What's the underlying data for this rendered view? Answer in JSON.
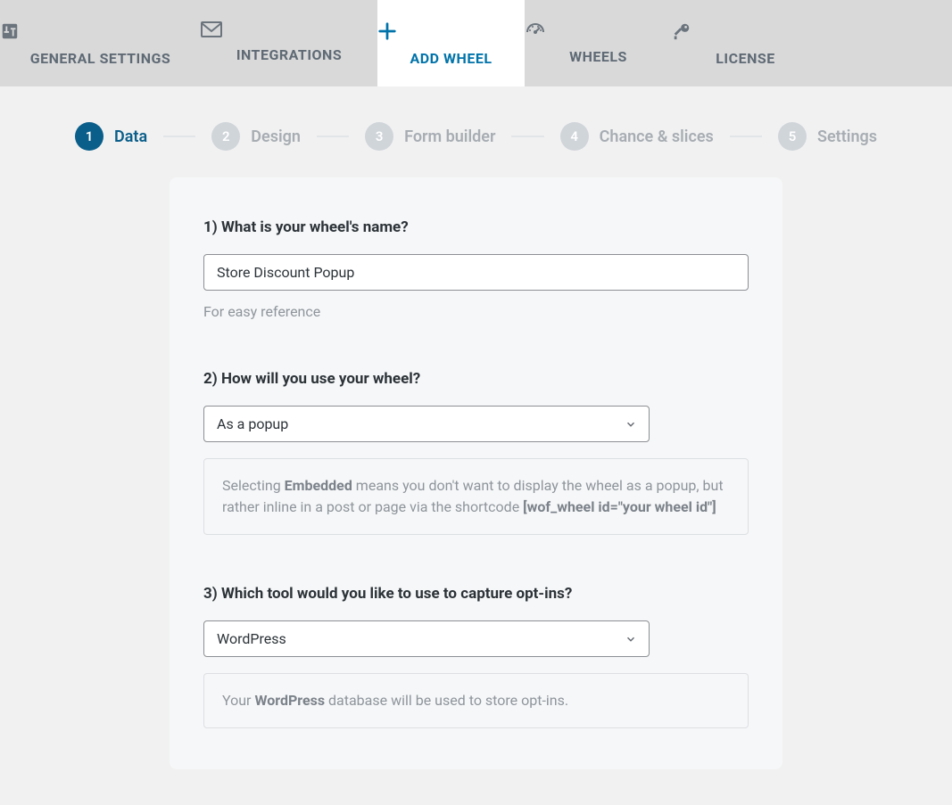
{
  "topTabs": [
    {
      "id": "general",
      "label": "GENERAL SETTINGS"
    },
    {
      "id": "integrations",
      "label": "INTEGRATIONS"
    },
    {
      "id": "addwheel",
      "label": "ADD WHEEL",
      "active": true
    },
    {
      "id": "wheels",
      "label": "WHEELS"
    },
    {
      "id": "license",
      "label": "LICENSE"
    }
  ],
  "steps": [
    {
      "num": "1",
      "label": "Data",
      "active": true
    },
    {
      "num": "2",
      "label": "Design"
    },
    {
      "num": "3",
      "label": "Form builder"
    },
    {
      "num": "4",
      "label": "Chance & slices"
    },
    {
      "num": "5",
      "label": "Settings"
    }
  ],
  "q1": {
    "label": "1) What is your wheel's name?",
    "value": "Store Discount Popup",
    "hint": "For easy reference"
  },
  "q2": {
    "label": "2) How will you use your wheel?",
    "selected": "As a popup",
    "help_pre": "Selecting ",
    "help_b1": "Embedded",
    "help_mid": " means you don't want to display the wheel as a popup, but rather inline in a post or page via the shortcode ",
    "help_b2": "[wof_wheel id=\"your wheel id\"]"
  },
  "q3": {
    "label": "3) Which tool would you like to use to capture opt-ins?",
    "selected": "WordPress",
    "help_pre": "Your ",
    "help_b": "WordPress",
    "help_post": " database will be used to store opt-ins."
  }
}
